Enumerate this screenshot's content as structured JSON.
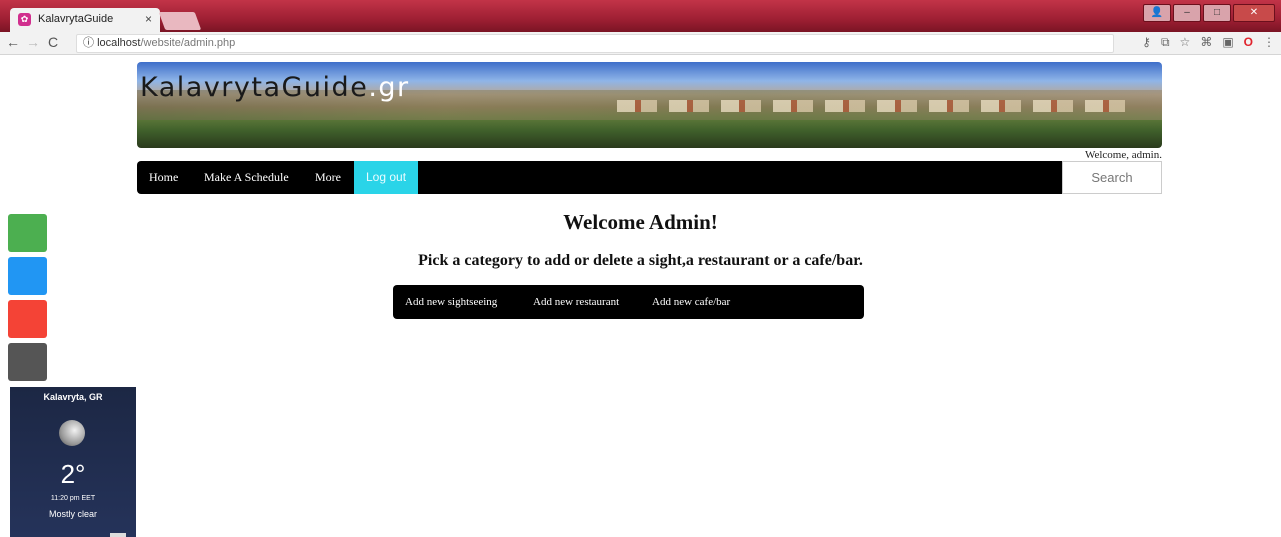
{
  "browser": {
    "tab_title": "KalavrytaGuide",
    "tab_close": "×",
    "url_host": "localhost",
    "url_path": "/website/admin.php",
    "url_info_icon": "info-icon"
  },
  "site": {
    "brand_name": "KalavrytaGuide",
    "brand_tld": ".gr",
    "welcome_user": "Welcome, admin."
  },
  "nav": {
    "items": [
      {
        "label": "Home"
      },
      {
        "label": "Make A Schedule"
      },
      {
        "label": "More"
      },
      {
        "label": "Log out"
      }
    ],
    "search_placeholder": "Search"
  },
  "main": {
    "title": "Welcome Admin!",
    "subtitle": "Pick a category to add or delete a sight,a restaurant or a cafe/bar.",
    "categories": [
      {
        "label": "Add new sightseeing"
      },
      {
        "label": "Add new restaurant"
      },
      {
        "label": "Add new cafe/bar"
      }
    ]
  },
  "social": [
    {
      "icon": "green-share-icon",
      "color": "#4caf50"
    },
    {
      "icon": "blue-share-icon",
      "color": "#2196f3"
    },
    {
      "icon": "red-share-icon",
      "color": "#f44336"
    },
    {
      "icon": "gray-share-icon",
      "color": "#555555"
    }
  ],
  "weather": {
    "city": "Kalavryta, GR",
    "temp": "2°",
    "time": "11:20 pm EET",
    "condition": "Mostly clear"
  }
}
